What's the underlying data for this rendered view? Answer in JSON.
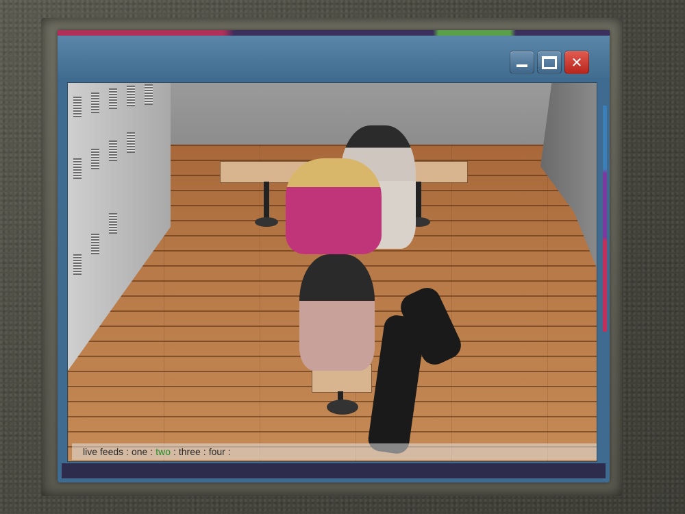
{
  "window": {
    "minimize_glyph": "minimize-icon",
    "maximize_glyph": "maximize-icon",
    "close_glyph": "✕",
    "accent_colors": [
      "#b0305a",
      "#3b2f5e",
      "#5aa04a"
    ],
    "titlebar_color": "#4a7699"
  },
  "feeds": {
    "label": "live feeds :",
    "items": [
      {
        "label": "one",
        "active": false
      },
      {
        "label": "two",
        "active": true
      },
      {
        "label": "three",
        "active": false
      },
      {
        "label": "four",
        "active": false
      }
    ],
    "separator": ":",
    "active_color": "#1f8f2a"
  }
}
